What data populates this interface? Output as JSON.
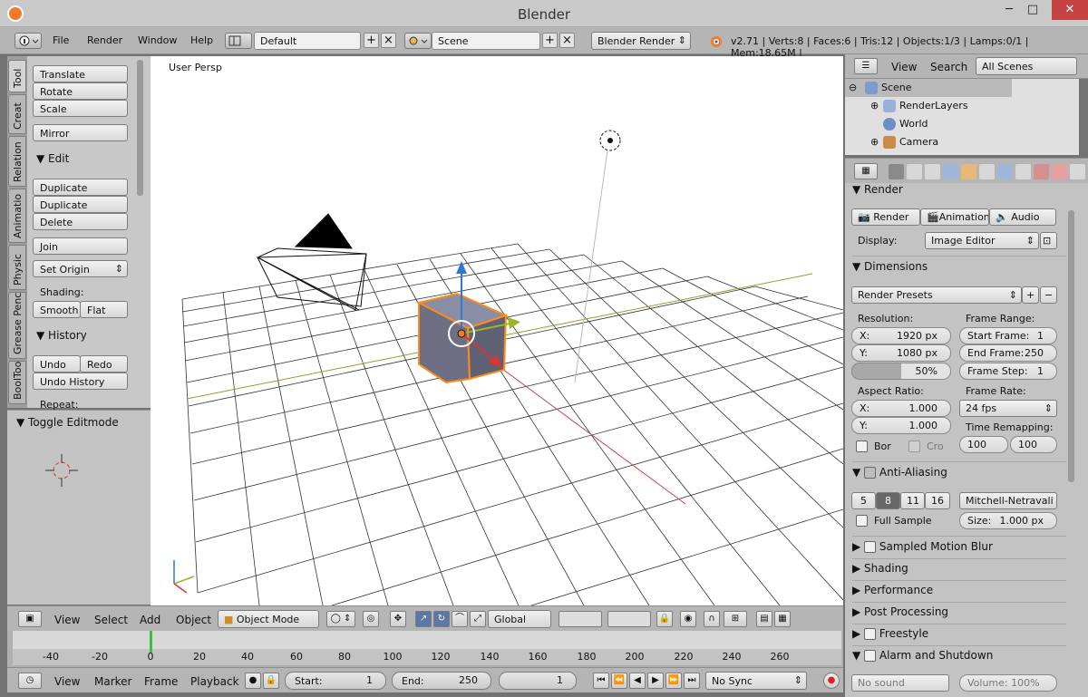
{
  "window": {
    "title": "Blender",
    "minimize": "─",
    "maximize": "□",
    "close": "✕"
  },
  "info": {
    "menus": [
      "File",
      "Render",
      "Window",
      "Help"
    ],
    "layout": "Default",
    "scene": "Scene",
    "engine": "Blender Render",
    "stats": "v2.71 | Verts:8 | Faces:6 | Tris:12 | Objects:1/3 | Lamps:0/1 | Mem:18.65M |"
  },
  "tool_tabs": [
    "Tool",
    "Creat",
    "Relation",
    "Animatio",
    "Physic",
    "Grease Penc",
    "BoolToo"
  ],
  "tools": {
    "transform": [
      "Translate",
      "Rotate",
      "Scale"
    ],
    "mirror": "Mirror",
    "edit_header": "Edit",
    "edit": [
      "Duplicate",
      "Duplicate Linked",
      "Delete"
    ],
    "join": "Join",
    "set_origin": "Set Origin",
    "shading_label": "Shading:",
    "smooth": "Smooth",
    "flat": "Flat",
    "history_header": "History",
    "undo": "Undo",
    "redo": "Redo",
    "undo_history": "Undo History",
    "repeat": "Repeat:"
  },
  "operator": {
    "title": "Toggle Editmode"
  },
  "viewport": {
    "label": "User Persp"
  },
  "view_header": {
    "menus": [
      "View",
      "Select",
      "Add",
      "Object"
    ],
    "mode": "Object Mode",
    "orientation": "Global"
  },
  "timeline": {
    "numbers": [
      "-40",
      "-20",
      "0",
      "20",
      "40",
      "60",
      "80",
      "100",
      "120",
      "140",
      "160",
      "180",
      "200",
      "220",
      "240",
      "260"
    ],
    "menus": [
      "View",
      "Marker",
      "Frame",
      "Playback"
    ],
    "start_label": "Start:",
    "start": "1",
    "end_label": "End:",
    "end": "250",
    "current": "1",
    "sync": "No Sync"
  },
  "outliner": {
    "menus": [
      "View",
      "Search"
    ],
    "filter": "All Scenes",
    "items": [
      "Scene",
      "RenderLayers",
      "World",
      "Camera"
    ]
  },
  "properties": {
    "render": {
      "header": "Render",
      "buttons": [
        "Render",
        "Animation",
        "Audio"
      ],
      "display_label": "Display:",
      "display": "Image Editor"
    },
    "dimensions": {
      "header": "Dimensions",
      "presets": "Render Presets",
      "resolution_label": "Resolution:",
      "res_x_label": "X:",
      "res_x": "1920 px",
      "res_y_label": "Y:",
      "res_y": "1080 px",
      "res_pct": "50%",
      "frame_range_label": "Frame Range:",
      "start_frame_label": "Start Frame:",
      "start_frame": "1",
      "end_frame_label": "End Frame:",
      "end_frame": "250",
      "frame_step_label": "Frame Step:",
      "frame_step": "1",
      "aspect_label": "Aspect Ratio:",
      "asp_x_label": "X:",
      "asp_x": "1.000",
      "asp_y_label": "Y:",
      "asp_y": "1.000",
      "frame_rate_label": "Frame Rate:",
      "frame_rate": "24 fps",
      "time_remap_label": "Time Remapping:",
      "remap_old": "100",
      "remap_new": "100",
      "border": "Bor",
      "crop": "Cro"
    },
    "anti_aliasing": {
      "header": "Anti-Aliasing",
      "samples": [
        "5",
        "8",
        "11",
        "16"
      ],
      "filter": "Mitchell-Netravali",
      "full_sample": "Full Sample",
      "size_label": "Size:",
      "size": "1.000 px"
    },
    "panels": [
      "Sampled Motion Blur",
      "Shading",
      "Performance",
      "Post Processing",
      "Freestyle",
      "Alarm and Shutdown"
    ],
    "bottom": {
      "sound": "No sound",
      "volume": "Volume: 100%"
    }
  }
}
